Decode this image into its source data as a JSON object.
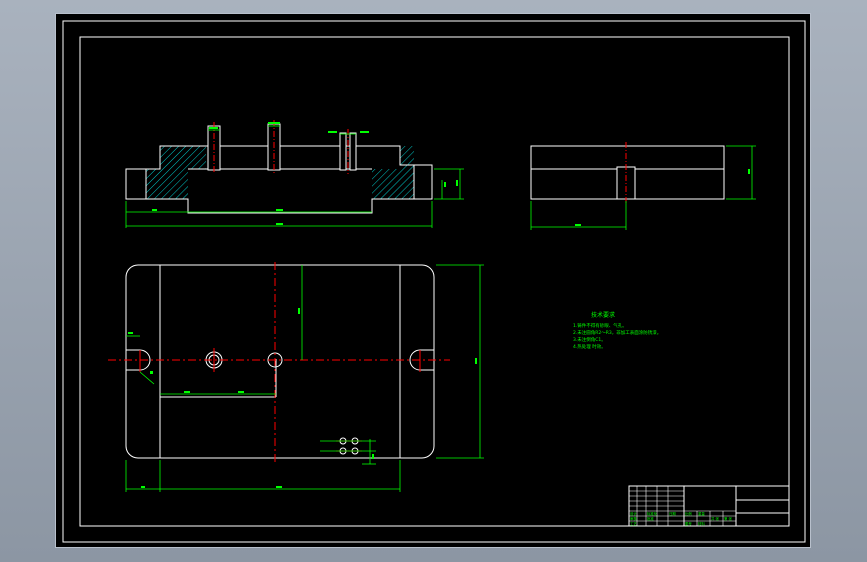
{
  "drawing": {
    "background_color": "#000000",
    "frame_color": "#ffffff",
    "dimension_color": "#00ff00",
    "centerline_color": "#ff0000",
    "hatch_color": "#00c8c8"
  },
  "notes": {
    "title": "技术要求",
    "lines": [
      "1.铸件不得有砂眼、气孔。",
      "2.未注圆角R2～R3，非加工表面涂防锈漆。",
      "3.未注倒角C1。",
      "4.热处理 时效。"
    ]
  },
  "title_block": {
    "cells": [
      "设计",
      "审核",
      "工艺",
      "标准化",
      "批准",
      "日期",
      "比例",
      "重量",
      "共 张",
      "第 张",
      "图号",
      "材料"
    ]
  }
}
